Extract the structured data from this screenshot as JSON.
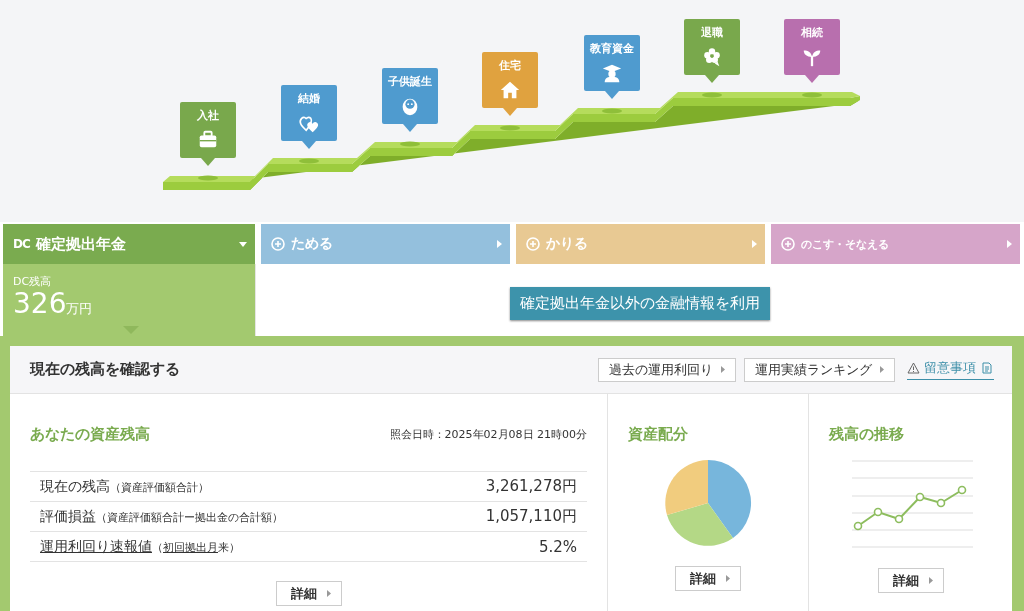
{
  "life_events": [
    {
      "label": "入社",
      "color": "#79a84c"
    },
    {
      "label": "結婚",
      "color": "#4f9bcf"
    },
    {
      "label": "子供誕生",
      "color": "#4f9bcf"
    },
    {
      "label": "住宅",
      "color": "#e0a23f"
    },
    {
      "label": "教育資金",
      "color": "#4f9bcf"
    },
    {
      "label": "退職",
      "color": "#79a84c"
    },
    {
      "label": "相続",
      "color": "#b86fae"
    }
  ],
  "tabs": [
    {
      "logo": "DC",
      "label": "確定拠出年金",
      "selected": true,
      "color": "#7aab4f"
    },
    {
      "label": "ためる",
      "selected": false,
      "color": "#94c0dd"
    },
    {
      "label": "かりる",
      "selected": false,
      "color": "#e8c993"
    },
    {
      "label": "のこす・そなえる",
      "selected": false,
      "color": "#d6a5c9"
    }
  ],
  "balance_summary": {
    "label": "DC残高",
    "amount": "326",
    "unit": "万円"
  },
  "other_info_button": "確定拠出年金以外の金融情報を利用",
  "panel": {
    "title": "現在の残高を確認する",
    "buttons": [
      "過去の運用利回り",
      "運用実績ランキング"
    ],
    "notice_link": "留意事項"
  },
  "assets": {
    "title": "あなたの資産残高",
    "as_of": "照会日時：2025年02月08日 21時00分",
    "rows": [
      {
        "label": "現在の残高",
        "link": false,
        "note": [
          {
            "text": "（資産評価額合計）",
            "link": false
          }
        ],
        "value": "3,261,278円"
      },
      {
        "label": "評価損益",
        "link": false,
        "note": [
          {
            "text": "（資産評価額合計ー拠出金の合計額）",
            "link": false
          }
        ],
        "value": "1,057,110円"
      },
      {
        "label": "運用利回り速報値",
        "link": true,
        "note": [
          {
            "text": "（",
            "link": false
          },
          {
            "text": "初回拠出月",
            "link": true
          },
          {
            "text": "来）",
            "link": false
          }
        ],
        "value": "5.2%"
      }
    ],
    "detail_button": "詳細"
  },
  "allocation": {
    "title": "資産配分",
    "detail_button": "詳細"
  },
  "trend": {
    "title": "残高の推移",
    "detail_button": "詳細"
  }
}
